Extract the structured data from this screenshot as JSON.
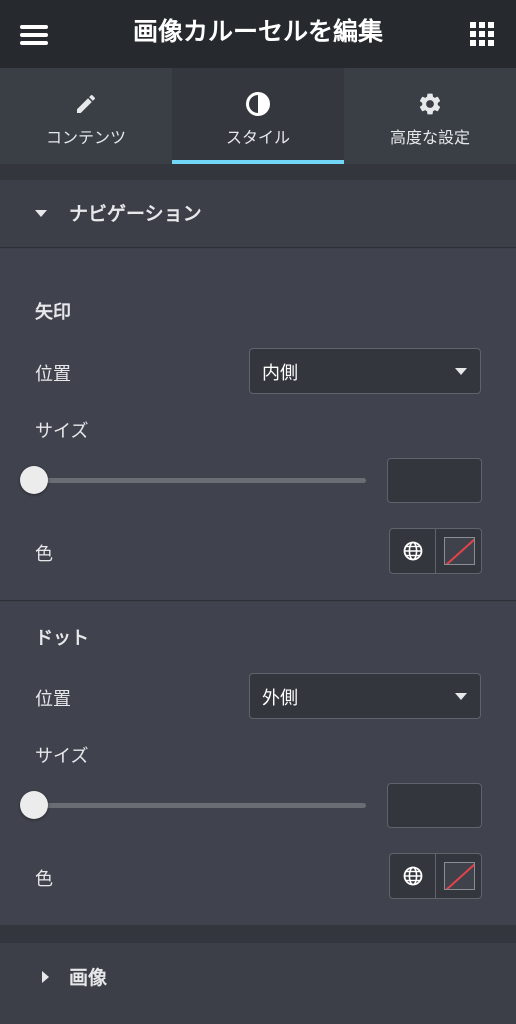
{
  "header": {
    "title": "画像カルーセルを編集",
    "menu_icon": "hamburger-menu-icon",
    "apps_icon": "grid-apps-icon"
  },
  "tabs": [
    {
      "label": "コンテンツ",
      "icon": "pencil-icon",
      "active": false
    },
    {
      "label": "スタイル",
      "icon": "contrast-half-circle-icon",
      "active": true
    },
    {
      "label": "高度な設定",
      "icon": "gear-icon",
      "active": false
    }
  ],
  "colors": {
    "accent": "#71d7f7",
    "header_bg": "#26292e",
    "panel_bg": "#40434d",
    "no_color_slash": "#e2434b"
  },
  "navigation_section": {
    "title": "ナビゲーション",
    "expanded": true,
    "arrows": {
      "heading": "矢印",
      "position_label": "位置",
      "position_value": "内側",
      "size_label": "サイズ",
      "size_value": "",
      "color_label": "色"
    },
    "dots": {
      "heading": "ドット",
      "position_label": "位置",
      "position_value": "外側",
      "size_label": "サイズ",
      "size_value": "",
      "color_label": "色"
    }
  },
  "image_section": {
    "title": "画像",
    "expanded": false
  }
}
